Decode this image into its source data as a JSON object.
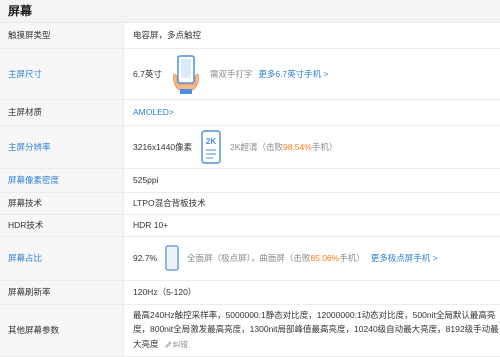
{
  "section": {
    "title": "屏幕"
  },
  "rows": {
    "touch_type": {
      "label": "触摸屏类型",
      "value": "电容屏，多点触控"
    },
    "size": {
      "label": "主屏尺寸",
      "value": "6.7英寸",
      "note": "需双手打字",
      "link": "更多6.7英寸手机 >"
    },
    "material": {
      "label": "主屏材质",
      "value": "AMOLED>"
    },
    "resolution": {
      "label": "主屏分辨率",
      "value": "3216x1440像素",
      "badge": "2K",
      "note_prefix": "2K超清（击败",
      "percent": "98.54%",
      "note_suffix": "手机）"
    },
    "density": {
      "label": "屏幕像素密度",
      "value": "525ppi"
    },
    "tech": {
      "label": "屏幕技术",
      "value": "LTPO混合背板技术"
    },
    "hdr": {
      "label": "HDR技术",
      "value": "HDR 10+"
    },
    "ratio": {
      "label": "屏幕占比",
      "value": "92.7%",
      "note_prefix": "全面屏（极点屏），曲面屏（击败",
      "percent": "85.06%",
      "note_suffix": "手机）",
      "link": "更多极点屏手机 >"
    },
    "refresh": {
      "label": "屏幕刷新率",
      "value": "120Hz（5-120）"
    },
    "other": {
      "label": "其他屏幕参数",
      "line1": "最高240Hz触控采样率，5000000:1静态对比度，12000000:1动态对比度，500nit全局默认最高亮",
      "line2": "度，800nit全局激发最高亮度，1300nit局部峰值最高亮度，10240级自动最大亮度，8192级手动最",
      "line3": "大亮度",
      "correction": "纠错"
    }
  },
  "colors": {
    "link": "#2e7fd6",
    "highlight": "#ff7a1a",
    "label_bg": "#f7f7f7",
    "header_bg": "#f4f4f4"
  },
  "icons": {
    "size": "hand-typing-phone-icon",
    "resolution": "phone-2k-icon",
    "ratio": "fullscreen-phone-icon",
    "correction": "pencil-icon"
  }
}
